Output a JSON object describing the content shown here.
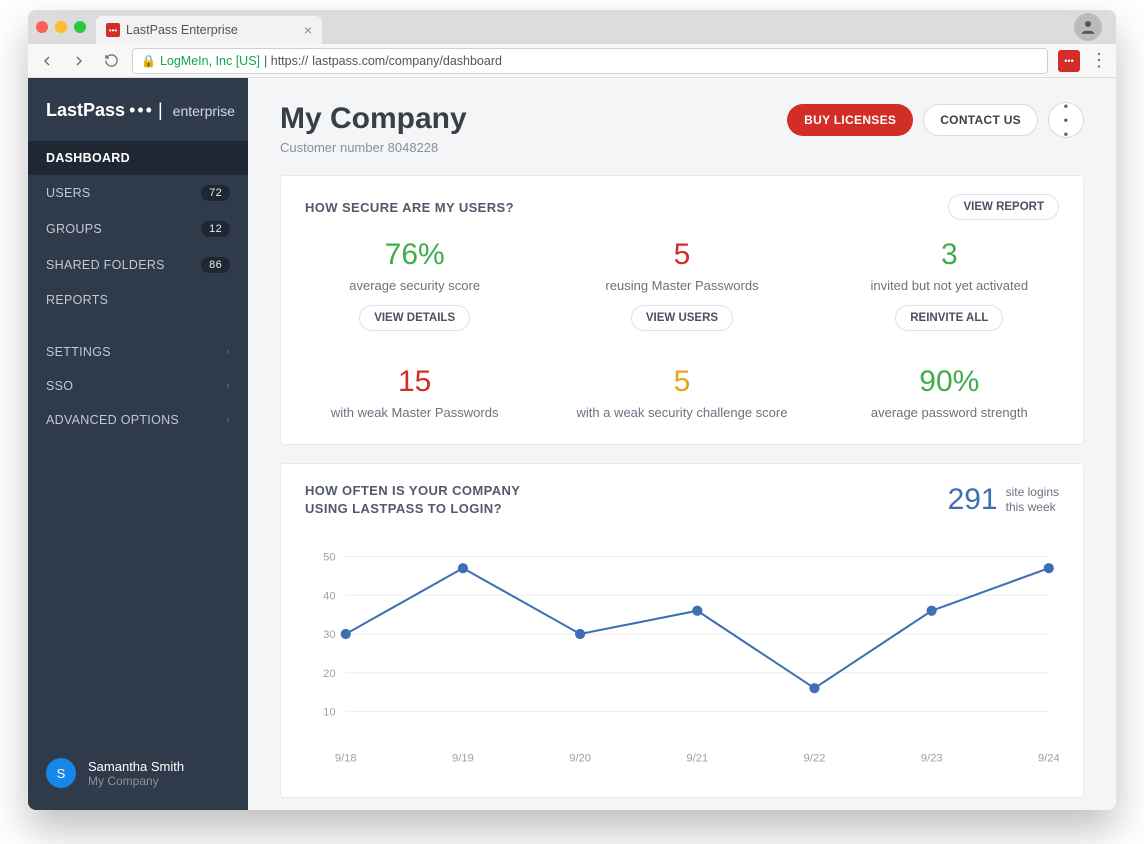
{
  "browser": {
    "tab_title": "LastPass Enterprise",
    "secure_org": "LogMeIn, Inc [US]",
    "url_prefix": " | https://",
    "url_rest": "lastpass.com/company/dashboard"
  },
  "brand": {
    "name": "LastPass",
    "dots": "•••",
    "pipe": "|",
    "edition": "enterprise"
  },
  "sidebar": {
    "items": [
      {
        "label": "DASHBOARD"
      },
      {
        "label": "USERS",
        "badge": "72"
      },
      {
        "label": "GROUPS",
        "badge": "12"
      },
      {
        "label": "SHARED FOLDERS",
        "badge": "86"
      },
      {
        "label": "REPORTS"
      }
    ],
    "section2": [
      {
        "label": "SETTINGS"
      },
      {
        "label": "SSO"
      },
      {
        "label": "ADVANCED OPTIONS"
      }
    ]
  },
  "user": {
    "initial": "S",
    "name": "Samantha Smith",
    "company": "My Company"
  },
  "header": {
    "title": "My Company",
    "subtitle": "Customer number 8048228",
    "buy": "BUY LICENSES",
    "contact": "CONTACT US"
  },
  "secure_card": {
    "title": "HOW SECURE ARE MY USERS?",
    "view_report": "VIEW REPORT",
    "metrics_top": [
      {
        "value": "76%",
        "color": "green",
        "label": "average security score",
        "action": "VIEW DETAILS"
      },
      {
        "value": "5",
        "color": "red",
        "label": "reusing Master Passwords",
        "action": "VIEW USERS"
      },
      {
        "value": "3",
        "color": "green",
        "label": "invited but not yet activated",
        "action": "REINVITE ALL"
      }
    ],
    "metrics_bottom": [
      {
        "value": "15",
        "color": "red",
        "label": "with weak Master Passwords"
      },
      {
        "value": "5",
        "color": "orange",
        "label": "with a weak security challenge score"
      },
      {
        "value": "90%",
        "color": "green",
        "label": "average password strength"
      }
    ]
  },
  "login_card": {
    "title": "HOW OFTEN IS YOUR COMPANY USING LASTPASS TO LOGIN?",
    "count_value": "291",
    "count_label_a": "site logins",
    "count_label_b": "this week"
  },
  "chart_data": {
    "type": "line",
    "categories": [
      "9/18",
      "9/19",
      "9/20",
      "9/21",
      "9/22",
      "9/23",
      "9/24"
    ],
    "values": [
      30,
      47,
      30,
      36,
      16,
      36,
      47
    ],
    "y_ticks": [
      10,
      20,
      30,
      40,
      50
    ],
    "ylim": [
      5,
      55
    ]
  }
}
